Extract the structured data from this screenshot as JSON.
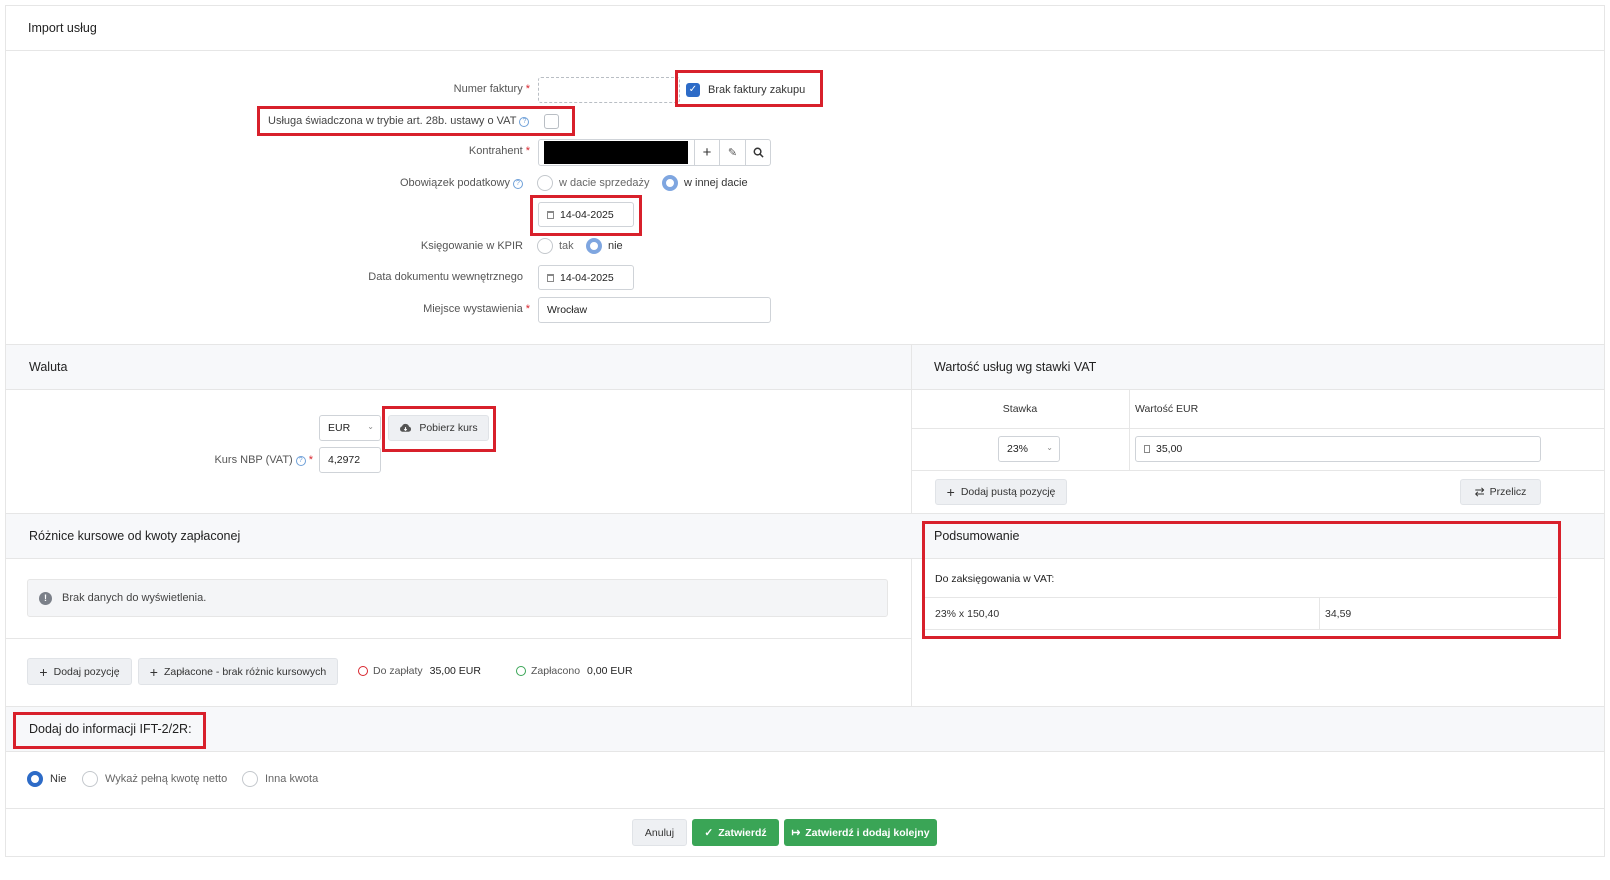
{
  "title": "Import usług",
  "form": {
    "invoice_number_label": "Numer faktury",
    "invoice_number_value": "",
    "no_invoice_label": "Brak faktury zakupu",
    "service_28b_label": "Usługa świadczona w trybie art. 28b. ustawy o VAT",
    "contractor_label": "Kontrahent",
    "tax_obligation_label": "Obowiązek podatkowy",
    "tax_option_sale": "w dacie sprzedaży",
    "tax_option_other": "w innej dacie",
    "tax_date_value": "14-04-2025",
    "kpir_label": "Księgowanie w KPIR",
    "kpir_yes": "tak",
    "kpir_no": "nie",
    "internal_doc_date_label": "Data dokumentu wewnętrznego",
    "internal_doc_date_value": "14-04-2025",
    "place_label": "Miejsce wystawienia",
    "place_value": "Wrocław"
  },
  "currency": {
    "header": "Waluta",
    "selected": "EUR",
    "fetch_button": "Pobierz kurs",
    "rate_label": "Kurs NBP (VAT)",
    "rate_value": "4,2972"
  },
  "vat_values": {
    "header": "Wartość usług wg stawki VAT",
    "col_rate": "Stawka",
    "col_value": "Wartość EUR",
    "rows": [
      {
        "rate": "23%",
        "value": "35,00"
      }
    ],
    "add_empty_button": "Dodaj pustą pozycję",
    "recalc_button": "Przelicz"
  },
  "fx_diff": {
    "header": "Różnice kursowe od kwoty zapłaconej",
    "empty_message": "Brak danych do wyświetlenia.",
    "add_item_button": "Dodaj pozycję",
    "paid_no_diff_button": "Zapłacone - brak różnic kursowych",
    "to_pay_label": "Do zapłaty",
    "to_pay_value": "35,00 EUR",
    "paid_label": "Zapłacono",
    "paid_value": "0,00 EUR"
  },
  "summary": {
    "header": "Podsumowanie",
    "subheader": "Do zaksięgowania w VAT:",
    "rows": [
      {
        "desc": "23% x 150,40",
        "amount": "34,59"
      }
    ]
  },
  "ift": {
    "header": "Dodaj do informacji IFT-2/2R:",
    "options": [
      "Nie",
      "Wykaż pełną kwotę netto",
      "Inna kwota"
    ]
  },
  "footer": {
    "cancel": "Anuluj",
    "confirm": "Zatwierdź",
    "confirm_next": "Zatwierdź i dodaj kolejny"
  },
  "colors": {
    "accent": "#2d6bc7",
    "green": "#3aa556",
    "highlight_red": "#d8202b"
  }
}
